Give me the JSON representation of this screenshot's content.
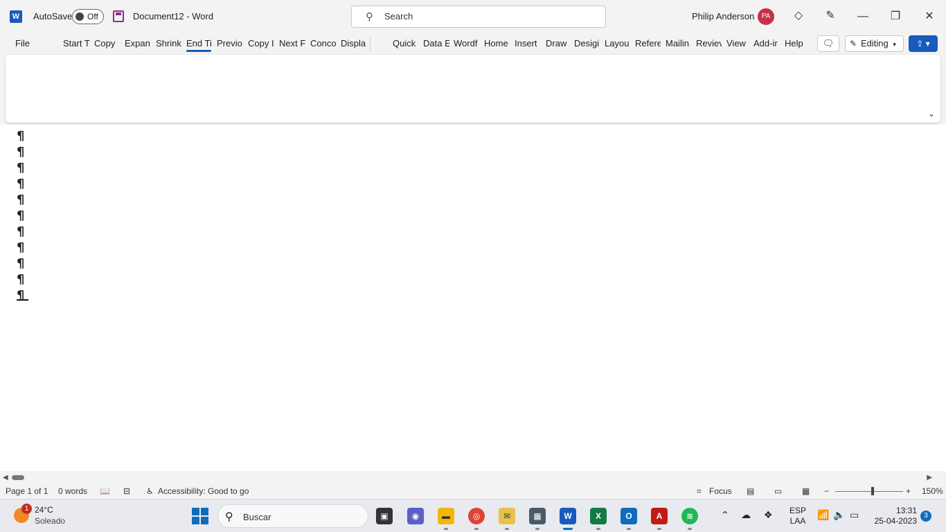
{
  "titlebar": {
    "app_letter": "W",
    "autosave_label": "AutoSave",
    "autosave_state": "Off",
    "doc_title": "Document12  -  Word",
    "search_placeholder": "Search",
    "user_name": "Philip Anderson",
    "user_initials": "PA"
  },
  "tabs": [
    {
      "label": "File"
    },
    {
      "label": "Start T"
    },
    {
      "label": "Copy"
    },
    {
      "label": "Expan"
    },
    {
      "label": "Shrink"
    },
    {
      "label": "End Ti"
    },
    {
      "label": "Previo"
    },
    {
      "label": "Copy I"
    },
    {
      "label": "Next F"
    },
    {
      "label": "Conco"
    },
    {
      "label": "Displa"
    },
    {
      "label": "Quick"
    },
    {
      "label": "Data E"
    },
    {
      "label": "Wordf"
    },
    {
      "label": "Home"
    },
    {
      "label": "Insert"
    },
    {
      "label": "Draw"
    },
    {
      "label": "Desigi"
    },
    {
      "label": "Layou"
    },
    {
      "label": "Refere"
    },
    {
      "label": "Mailin"
    },
    {
      "label": "Reviev"
    },
    {
      "label": "View"
    },
    {
      "label": "Add-ir"
    },
    {
      "label": "Help"
    }
  ],
  "active_tab": "End Ti",
  "ribbon_right": {
    "editing_label": "Editing"
  },
  "document": {
    "paragraph_mark": "¶",
    "paragraph_count": 11
  },
  "statusbar": {
    "page": "Page 1 of 1",
    "words": "0 words",
    "accessibility": "Accessibility: Good to go",
    "focus": "Focus",
    "zoom": "150%"
  },
  "taskbar": {
    "weather_badge": "1",
    "temperature": "24°C",
    "condition": "Soleado",
    "search_label": "Buscar",
    "lang_line1": "ESP",
    "lang_line2": "LAA",
    "time": "13:31",
    "date": "25-04-2023",
    "notification_count": "3"
  },
  "colors": {
    "word_blue": "#185abd",
    "avatar": "#c4314b",
    "accent": "#0f6cbd"
  }
}
